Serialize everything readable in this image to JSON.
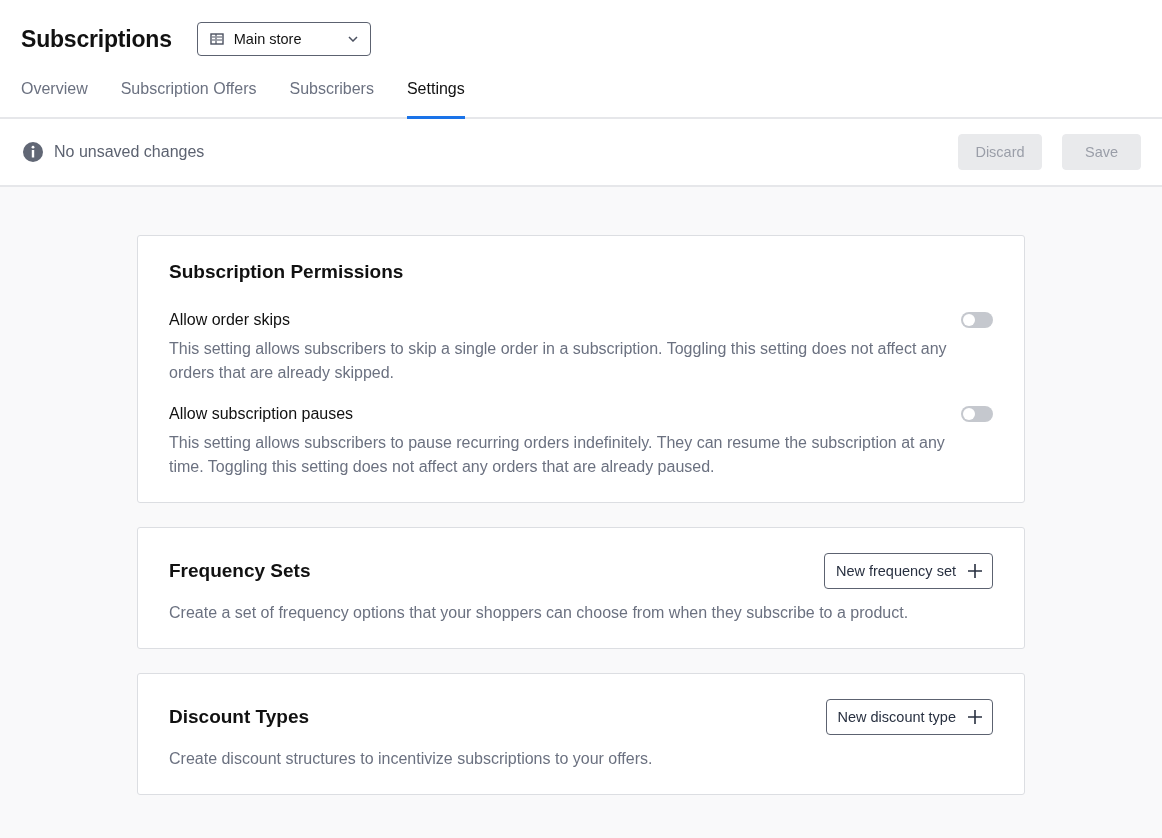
{
  "header": {
    "title": "Subscriptions",
    "store_select": {
      "value": "Main store"
    }
  },
  "tabs": [
    {
      "label": "Overview",
      "selected": false
    },
    {
      "label": "Subscription Offers",
      "selected": false
    },
    {
      "label": "Subscribers",
      "selected": false
    },
    {
      "label": "Settings",
      "selected": true
    }
  ],
  "status_bar": {
    "message": "No unsaved changes",
    "buttons": [
      {
        "label": "Discard",
        "disabled": true
      },
      {
        "label": "Save",
        "disabled": true
      }
    ]
  },
  "cards": [
    {
      "title": "Subscription Permissions",
      "settings": [
        {
          "label": "Allow order skips",
          "on": false,
          "description": "This setting allows subscribers to skip a single order in a subscription. Toggling this setting does not affect any orders that are already skipped."
        },
        {
          "label": "Allow subscription pauses",
          "on": false,
          "description": "This setting allows subscribers to pause recurring orders indefinitely. They can resume the subscription at any time. Toggling this setting does not affect any orders that are already paused."
        }
      ]
    },
    {
      "title": "Frequency Sets",
      "button": "New frequency set",
      "description": "Create a set of frequency options that your shoppers can choose from when they subscribe to a product."
    },
    {
      "title": "Discount Types",
      "button": "New discount type",
      "description": "Create discount structures to incentivize subscriptions to your offers."
    }
  ]
}
